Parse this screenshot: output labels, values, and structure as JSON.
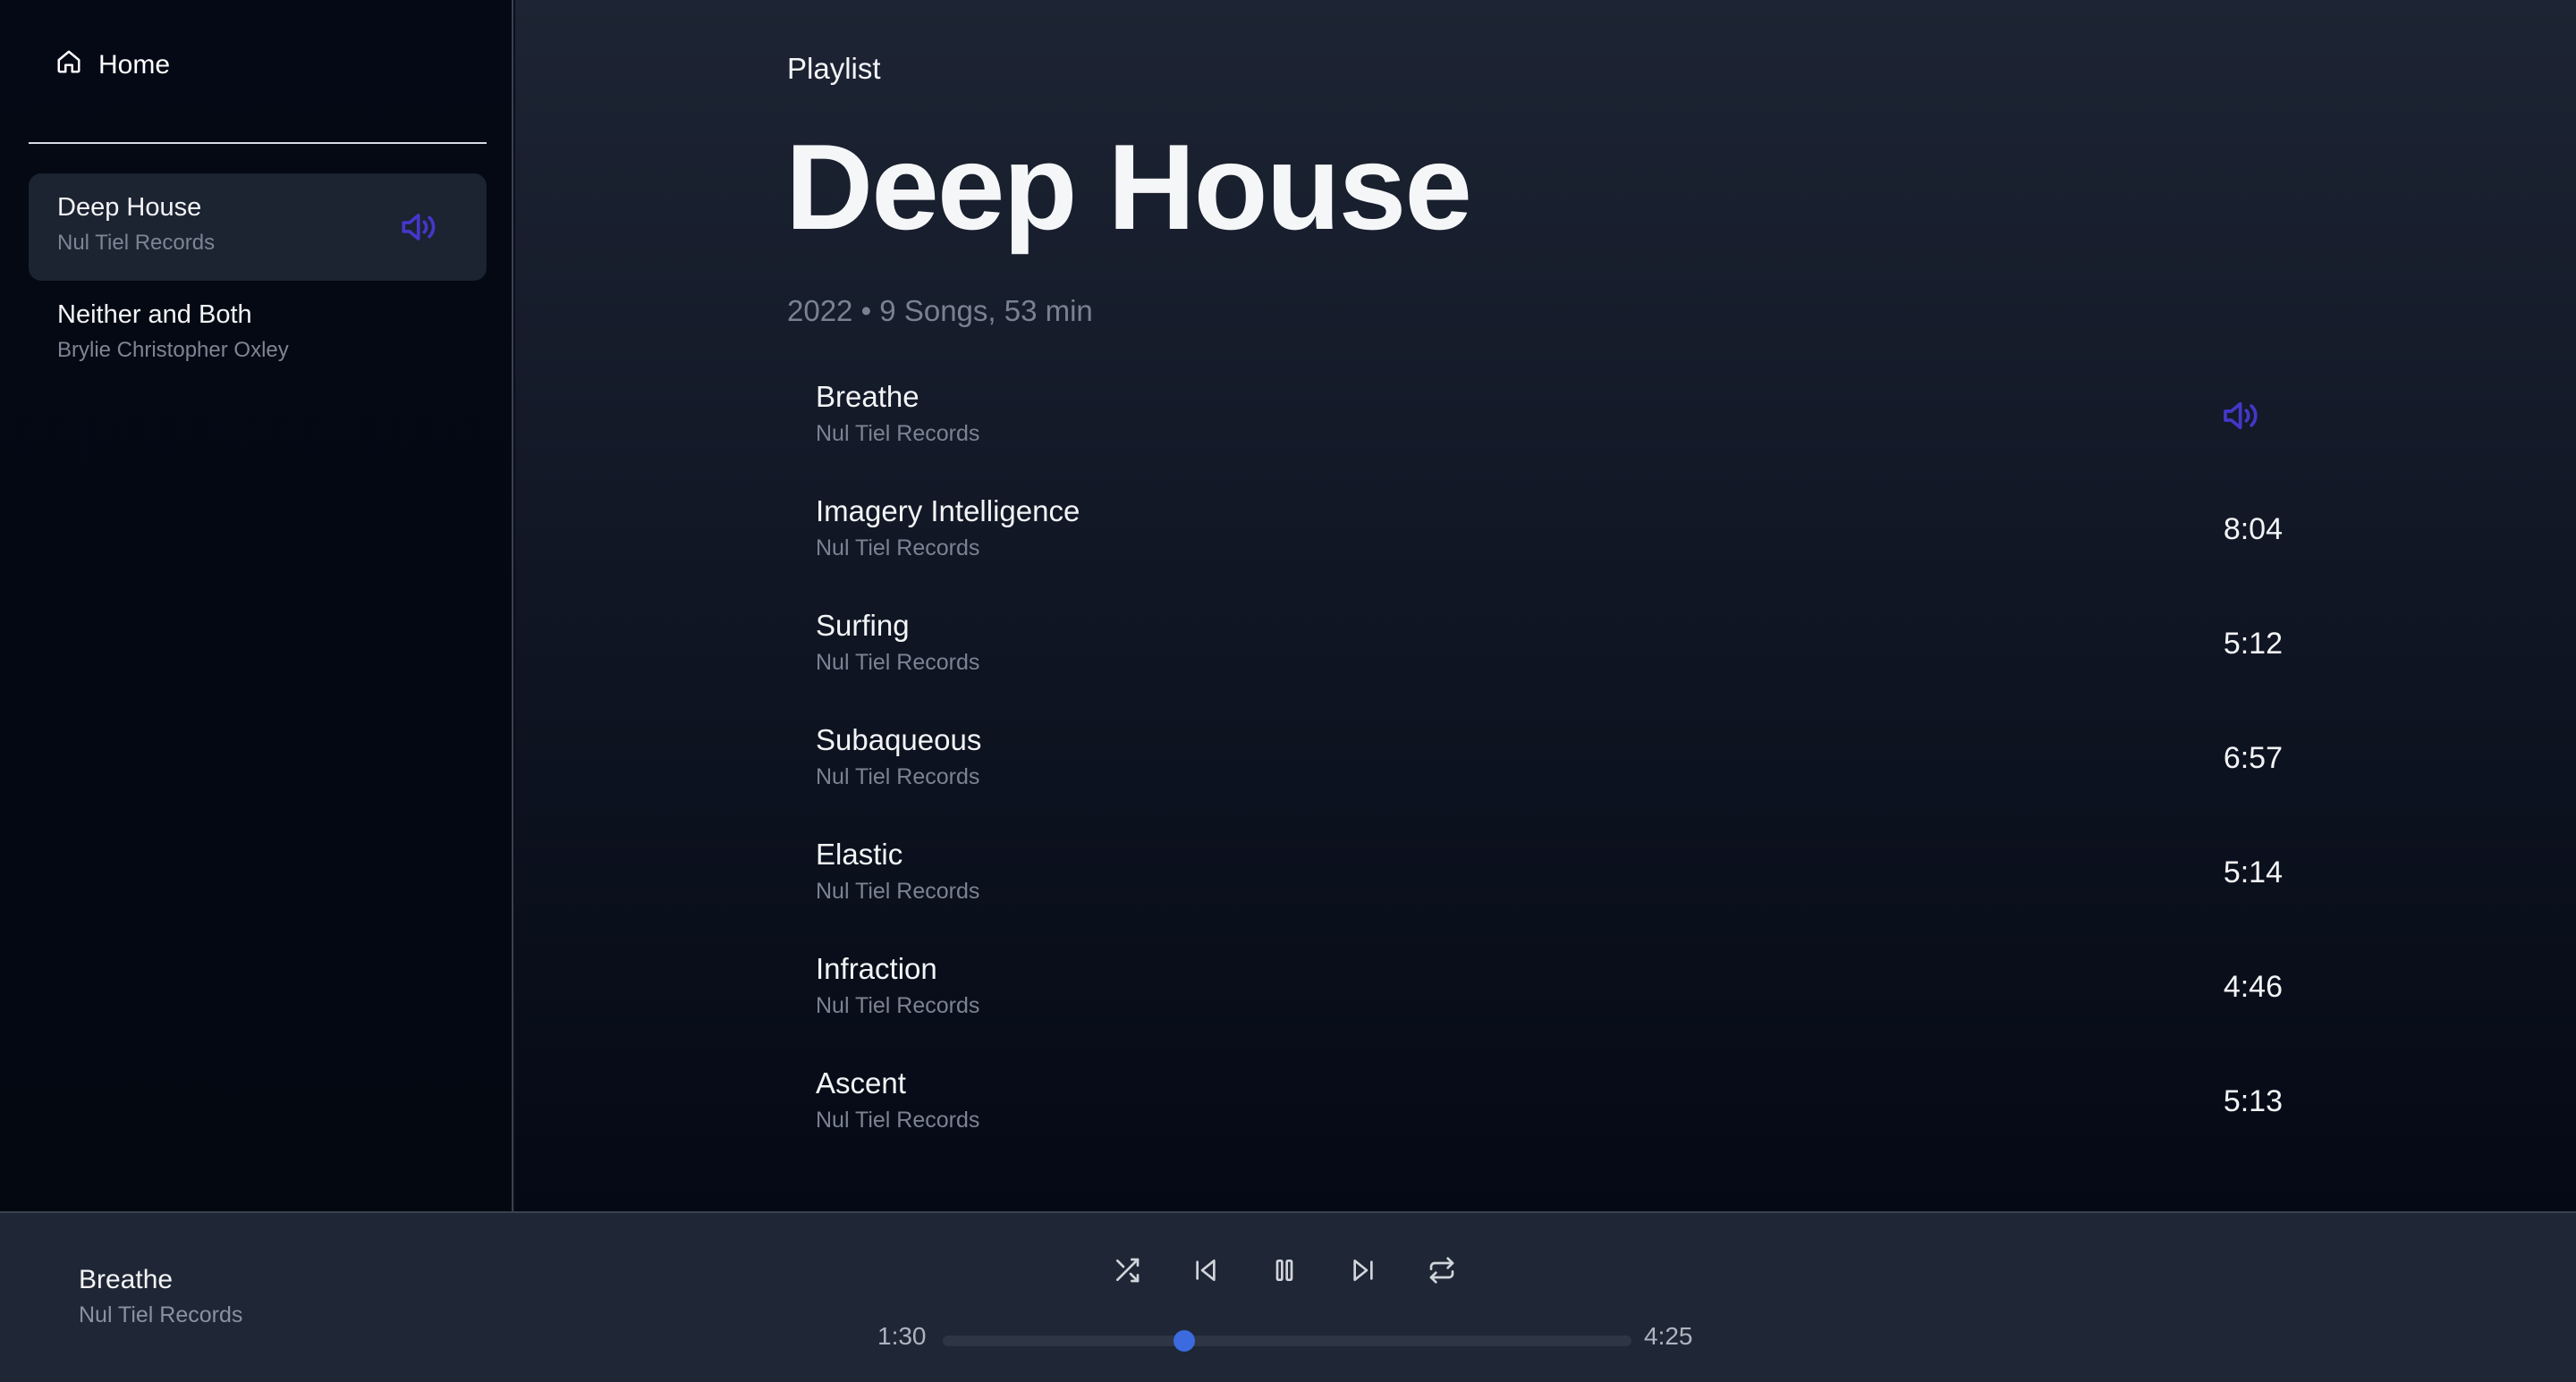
{
  "sidebar": {
    "home_label": "Home",
    "playlists": [
      {
        "title": "Deep House",
        "subtitle": "Nul Tiel Records",
        "active": true
      },
      {
        "title": "Neither and Both",
        "subtitle": "Brylie Christopher Oxley",
        "active": false
      }
    ]
  },
  "main": {
    "eyebrow": "Playlist",
    "title": "Deep House",
    "meta": "2022 • 9 Songs, 53 min",
    "tracks": [
      {
        "title": "Breathe",
        "artist": "Nul Tiel Records",
        "duration": "",
        "playing": true
      },
      {
        "title": "Imagery Intelligence",
        "artist": "Nul Tiel Records",
        "duration": "8:04"
      },
      {
        "title": "Surfing",
        "artist": "Nul Tiel Records",
        "duration": "5:12"
      },
      {
        "title": "Subaqueous",
        "artist": "Nul Tiel Records",
        "duration": "6:57"
      },
      {
        "title": "Elastic",
        "artist": "Nul Tiel Records",
        "duration": "5:14"
      },
      {
        "title": "Infraction",
        "artist": "Nul Tiel Records",
        "duration": "4:46"
      },
      {
        "title": "Ascent",
        "artist": "Nul Tiel Records",
        "duration": "5:13"
      }
    ]
  },
  "player": {
    "now_playing_title": "Breathe",
    "now_playing_artist": "Nul Tiel Records",
    "elapsed": "1:30",
    "total": "4:25",
    "progress_fraction": 0.35,
    "controls": [
      "shuffle-icon",
      "skip-back-icon",
      "pause-icon",
      "skip-forward-icon",
      "repeat-icon"
    ]
  },
  "colors": {
    "accent": "#4338ca",
    "progress": "#3b6bdf"
  }
}
